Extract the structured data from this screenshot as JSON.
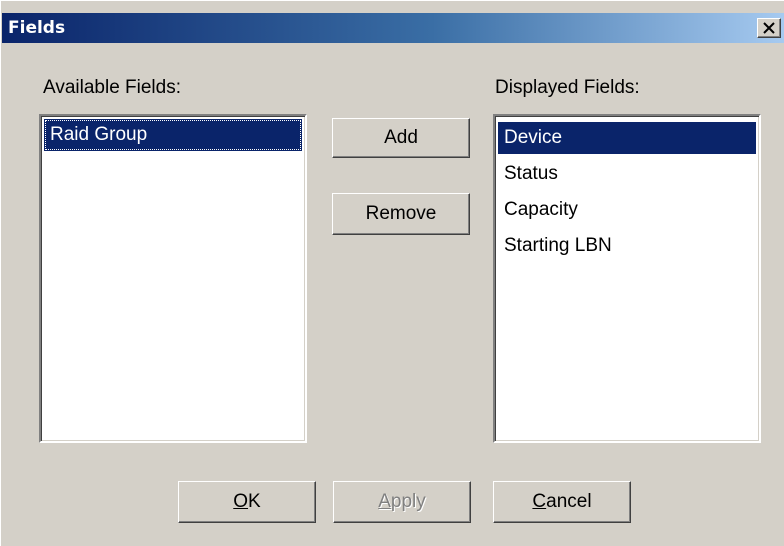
{
  "window": {
    "title": "Fields",
    "close_glyph": "×"
  },
  "available": {
    "label": "Available Fields:",
    "items": [
      "Raid Group"
    ],
    "selected_index": 0
  },
  "displayed": {
    "label": "Displayed Fields:",
    "items": [
      "Device",
      "Status",
      "Capacity",
      "Starting LBN"
    ],
    "selected_index": 0
  },
  "buttons": {
    "add": "Add",
    "remove": "Remove",
    "ok_mnemonic": "O",
    "ok_rest": "K",
    "apply_mnemonic": "A",
    "apply_rest": "pply",
    "cancel_mnemonic": "C",
    "cancel_rest": "ancel"
  },
  "colors": {
    "title_gradient_start": "#0a246a",
    "title_gradient_end": "#a6caf0",
    "selection": "#0a246a",
    "dialog_face": "#d4d0c8"
  }
}
